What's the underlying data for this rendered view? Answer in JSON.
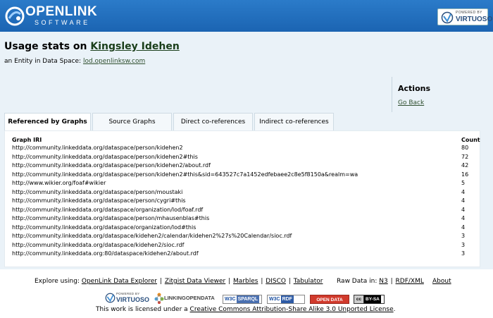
{
  "header": {
    "logo_name": "OPENLINK",
    "logo_sub": "SOFTWARE",
    "badge_small": "POWERED BY",
    "badge_big": "VIRTUOSO",
    "colors": {
      "bar": "#1f6cbc",
      "link": "#2f4f2f",
      "content_bg": "#eaf2f8"
    }
  },
  "page": {
    "title_prefix": "Usage stats on",
    "title_link": "Kingsley Idehen",
    "subtitle_prefix": "an Entity in Data Space:",
    "subtitle_link": "lod.openlinksw.com"
  },
  "actions": {
    "title": "Actions",
    "go_back": "Go Back"
  },
  "tabs": [
    {
      "label": "Referenced by Graphs",
      "active": true
    },
    {
      "label": "Source Graphs",
      "active": false
    },
    {
      "label": "Direct co-references",
      "active": false
    },
    {
      "label": "Indirect co-references",
      "active": false
    }
  ],
  "table": {
    "headers": {
      "iri": "Graph IRI",
      "count": "Count"
    },
    "rows": [
      {
        "iri": "http://community.linkeddata.org/dataspace/person/kidehen2",
        "count": "80"
      },
      {
        "iri": "http://community.linkeddata.org/dataspace/person/kidehen2#this",
        "count": "72"
      },
      {
        "iri": "http://community.linkeddata.org/dataspace/person/kidehen2/about.rdf",
        "count": "42"
      },
      {
        "iri": "http://community.linkeddata.org/dataspace/person/kidehen2#this&sid=643527c7a1452edfebaee2c8e5f8150a&realm=wa",
        "count": "16"
      },
      {
        "iri": "http://www.wikier.org/foaf#wikier",
        "count": "5"
      },
      {
        "iri": "http://community.linkeddata.org/dataspace/person/moustaki",
        "count": "4"
      },
      {
        "iri": "http://community.linkeddata.org/dataspace/person/cygri#this",
        "count": "4"
      },
      {
        "iri": "http://community.linkeddata.org/dataspace/organization/lod/foaf.rdf",
        "count": "4"
      },
      {
        "iri": "http://community.linkeddata.org/dataspace/person/mhausenblas#this",
        "count": "4"
      },
      {
        "iri": "http://community.linkeddata.org/dataspace/organization/lod#this",
        "count": "4"
      },
      {
        "iri": "http://community.linkeddata.org/dataspace/kidehen2/calendar/kidehen2%27s%20Calendar/sioc.rdf",
        "count": "3"
      },
      {
        "iri": "http://community.linkeddata.org/dataspace/kidehen2/sioc.rdf",
        "count": "3"
      },
      {
        "iri": "http://community.linkeddata.org:80/dataspace/kidehen2/about.rdf",
        "count": "3"
      }
    ]
  },
  "footer": {
    "explore_label": "Explore using:",
    "explore_links": [
      "OpenLink Data Explorer",
      "Zitgist Data Viewer",
      "Marbles",
      "DISCO",
      "Tabulator"
    ],
    "sep": "|",
    "raw_label": "Raw Data in:",
    "raw_links": [
      "N3",
      "RDF/XML"
    ],
    "about": "About",
    "badges": {
      "virtuoso_small": "POWERED BY",
      "virtuoso_big": "VIRTUOSO",
      "lod": "LINKINGOPENDATA",
      "w3c": "W3C",
      "sparql": "SPARQL",
      "rdf": "RDF",
      "open_data": "OPEN DATA",
      "cc_logo": "cc",
      "cc_text": "BY-SA"
    },
    "license_prefix": "This work is licensed under a",
    "license_link": "Creative Commons Attribution-Share Alike 3.0 Unported License",
    "license_suffix": "."
  }
}
